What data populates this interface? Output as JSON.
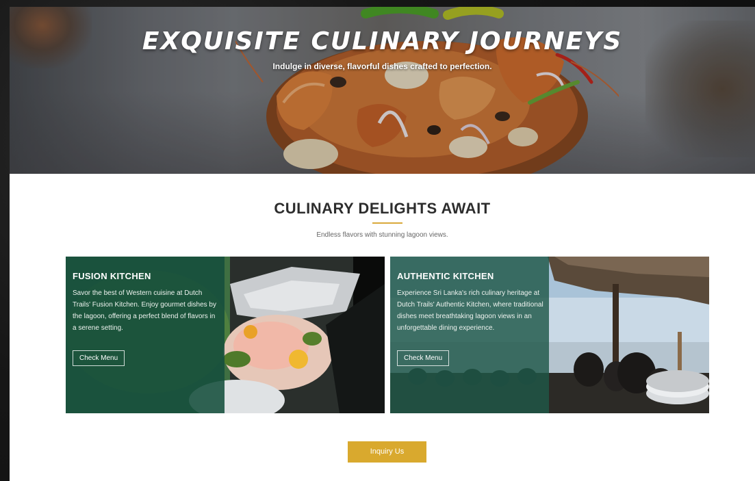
{
  "hero": {
    "title": "EXQUISITE CULINARY JOURNEYS",
    "subtitle": "Indulge in diverse, flavorful dishes crafted to perfection."
  },
  "section": {
    "title": "CULINARY DELIGHTS AWAIT",
    "subtitle": "Endless flavors with stunning lagoon views."
  },
  "cards": [
    {
      "title": "FUSION KITCHEN",
      "description": "Savor the best of Western cuisine at Dutch Trails' Fusion Kitchen. Enjoy gourmet dishes by the lagoon, offering a perfect blend of flavors in a serene setting.",
      "button_label": "Check Menu"
    },
    {
      "title": "AUTHENTIC KITCHEN",
      "description": "Experience Sri Lanka's rich culinary heritage at Dutch Trails' Authentic Kitchen, where traditional dishes meet breathtaking lagoon views in an unforgettable dining experience.",
      "button_label": "Check Menu"
    }
  ],
  "inquiry": {
    "button_label": "Inquiry Us"
  },
  "colors": {
    "accent": "#d9a92e",
    "card_panel": "#164e3c",
    "heading": "#2d2d2d"
  }
}
